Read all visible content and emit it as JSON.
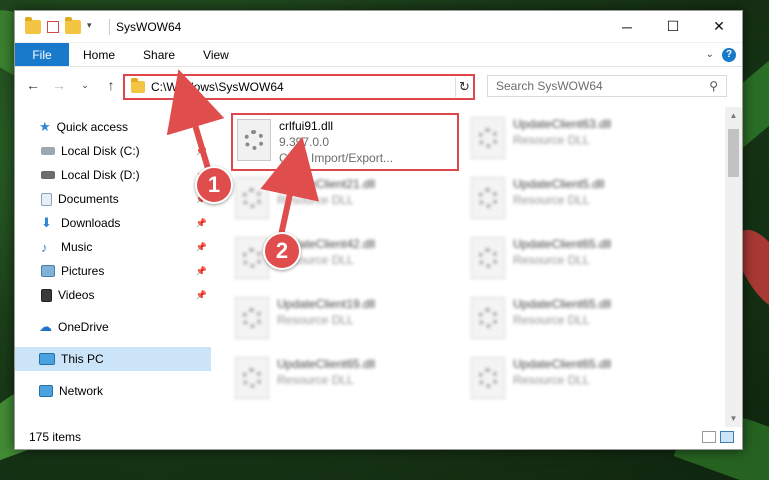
{
  "window": {
    "title": "SysWOW64"
  },
  "ribbon": {
    "tabs": [
      "File",
      "Home",
      "Share",
      "View"
    ]
  },
  "address": {
    "path": "C:\\Windows\\SysWOW64"
  },
  "search": {
    "placeholder": "Search SysWOW64"
  },
  "sidebar": {
    "quick_access": "Quick access",
    "items": [
      {
        "label": "Local Disk (C:)",
        "icon": "drive-icon"
      },
      {
        "label": "Local Disk (D:)",
        "icon": "drive-icon"
      },
      {
        "label": "Documents",
        "icon": "documents-icon"
      },
      {
        "label": "Downloads",
        "icon": "downloads-icon"
      },
      {
        "label": "Music",
        "icon": "music-icon"
      },
      {
        "label": "Pictures",
        "icon": "pictures-icon"
      },
      {
        "label": "Videos",
        "icon": "videos-icon"
      }
    ],
    "onedrive": "OneDrive",
    "thispc": "This PC",
    "network": "Network"
  },
  "files": [
    {
      "name": "crlfui91.dll",
      "version": "9.397.0.0",
      "desc": "Corel Import/Export..."
    },
    {
      "name": "UpdateClient63.dll",
      "desc": "Resource DLL"
    },
    {
      "name": "UpdateClient21.dll",
      "desc": "Resource DLL"
    },
    {
      "name": "UpdateClient5.dll",
      "desc": "Resource DLL"
    },
    {
      "name": "UpdateClient42.dll",
      "desc": "Resource DLL"
    },
    {
      "name": "UpdateClient65.dll",
      "desc": "Resource DLL"
    },
    {
      "name": "UpdateClient19.dll",
      "desc": "Resource DLL"
    },
    {
      "name": "UpdateClient65.dll",
      "desc": "Resource DLL"
    },
    {
      "name": "UpdateClient65.dll",
      "desc": "Resource DLL"
    },
    {
      "name": "UpdateClient65.dll",
      "desc": "Resource DLL"
    }
  ],
  "status": {
    "count": "175 items"
  },
  "callouts": [
    "1",
    "2"
  ],
  "colors": {
    "accent": "#1979ca",
    "highlight": "#e0474c",
    "selected": "#cce4f7"
  }
}
